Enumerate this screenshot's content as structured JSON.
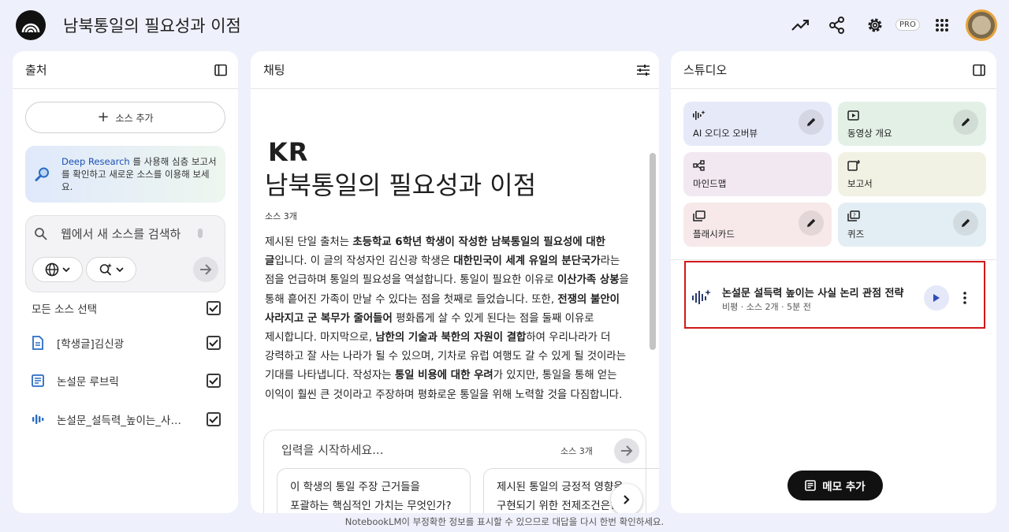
{
  "header": {
    "title": "남북통일의 필요성과 이점",
    "pro_label": "PRO"
  },
  "sources_panel": {
    "title": "출처",
    "add_source_label": "소스 추가",
    "deep_research": {
      "link": "Deep Research",
      "text": " 를 사용해 심층 보고서를 확인하고 새로운 소스를 이용해 보세요."
    },
    "search": {
      "placeholder": "웹에서 새 소스를 검색하"
    },
    "select_all_label": "모든 소스 선택",
    "items": [
      {
        "label": "[학생글]김신광",
        "icon": "document-icon",
        "checked": true
      },
      {
        "label": "논설문 루브릭",
        "icon": "text-document-icon",
        "checked": true
      },
      {
        "label": "논설문_설득력_높이는_사실...",
        "icon": "audio-icon",
        "checked": true
      }
    ]
  },
  "chat_panel": {
    "title": "채팅",
    "flag_text": "KR",
    "notebook_title": "남북통일의 필요성과 이점",
    "source_count": "소스 3개",
    "summary": [
      {
        "t": "제시된 단일 출처는 ",
        "b": false
      },
      {
        "t": "초등학교 6학년 학생이 작성한 남북통일의 필요성에 대한 글",
        "b": true
      },
      {
        "t": "입니다. 이 글의 작성자인 김신광 학생은 ",
        "b": false
      },
      {
        "t": "대한민국이 세계 유일의 분단국가",
        "b": true
      },
      {
        "t": "라는 점을 언급하며 통일의 필요성을 역설합니다. 통일이 필요한 이유로 ",
        "b": false
      },
      {
        "t": "이산가족 상봉",
        "b": true
      },
      {
        "t": "을 통해 흩어진 가족이 만날 수 있다는 점을 첫째로 들었습니다. 또한, ",
        "b": false
      },
      {
        "t": "전쟁의 불안이 사라지고 군 복무가 줄어들어",
        "b": true
      },
      {
        "t": " 평화롭게 살 수 있게 된다는 점을 둘째 이유로 제시합니다. 마지막으로, ",
        "b": false
      },
      {
        "t": "남한의 기술과 북한의 자원이 결합",
        "b": true
      },
      {
        "t": "하여 우리나라가 더 강력하고 잘 사는 나라가 될 수 있으며, 기차로 유럽 여행도 갈 수 있게 될 것이라는 기대를 나타냅니다. 작성자는 ",
        "b": false
      },
      {
        "t": "통일 비용에 대한 우려",
        "b": true
      },
      {
        "t": "가 있지만, 통일을 통해 얻는 이익이 훨씬 큰 것이라고 주장하며 평화로운 통일을 위해 노력할 것을 다짐합니다.",
        "b": false
      }
    ],
    "composer": {
      "placeholder": "입력을 시작하세요...",
      "source_count": "소스 3개"
    },
    "suggestions": [
      {
        "line1": "이 학생의 통일 주장 근거들을",
        "line2": "포괄하는 핵심적인 가치는 무엇인가?"
      },
      {
        "line1": "제시된 통일의 긍정적 영향을",
        "line2": "구현되기 위한 전제조건은?"
      }
    ]
  },
  "studio_panel": {
    "title": "스튜디오",
    "tiles": [
      {
        "label": "AI 오디오 오버뷰",
        "icon": "audio-overview-icon",
        "color": "#e6e9f8",
        "editable": true
      },
      {
        "label": "동영상 개요",
        "icon": "video-icon",
        "color": "#e3f0e6",
        "editable": true
      },
      {
        "label": "마인드맵",
        "icon": "mindmap-icon",
        "color": "#f1e8f1",
        "editable": false
      },
      {
        "label": "보고서",
        "icon": "report-icon",
        "color": "#f2f2e4",
        "editable": false
      },
      {
        "label": "플래시카드",
        "icon": "flashcard-icon",
        "color": "#f7e9e9",
        "editable": true
      },
      {
        "label": "퀴즈",
        "icon": "quiz-icon",
        "color": "#e3eef4",
        "editable": true
      }
    ],
    "artifact": {
      "title": "논설문 설득력 높이는 사실 논리 관점 전략",
      "meta": "비평 · 소스 2개 · 5분 전"
    },
    "memo_button": "메모 추가"
  },
  "footer": {
    "disclaimer": "NotebookLM이 부정확한 정보를 표시할 수 있으므로 대답을 다시 한번 확인하세요."
  },
  "colors": {
    "background": "#eef0fb",
    "highlight_border": "#d01818",
    "accent_blue": "#1a4fb5"
  }
}
